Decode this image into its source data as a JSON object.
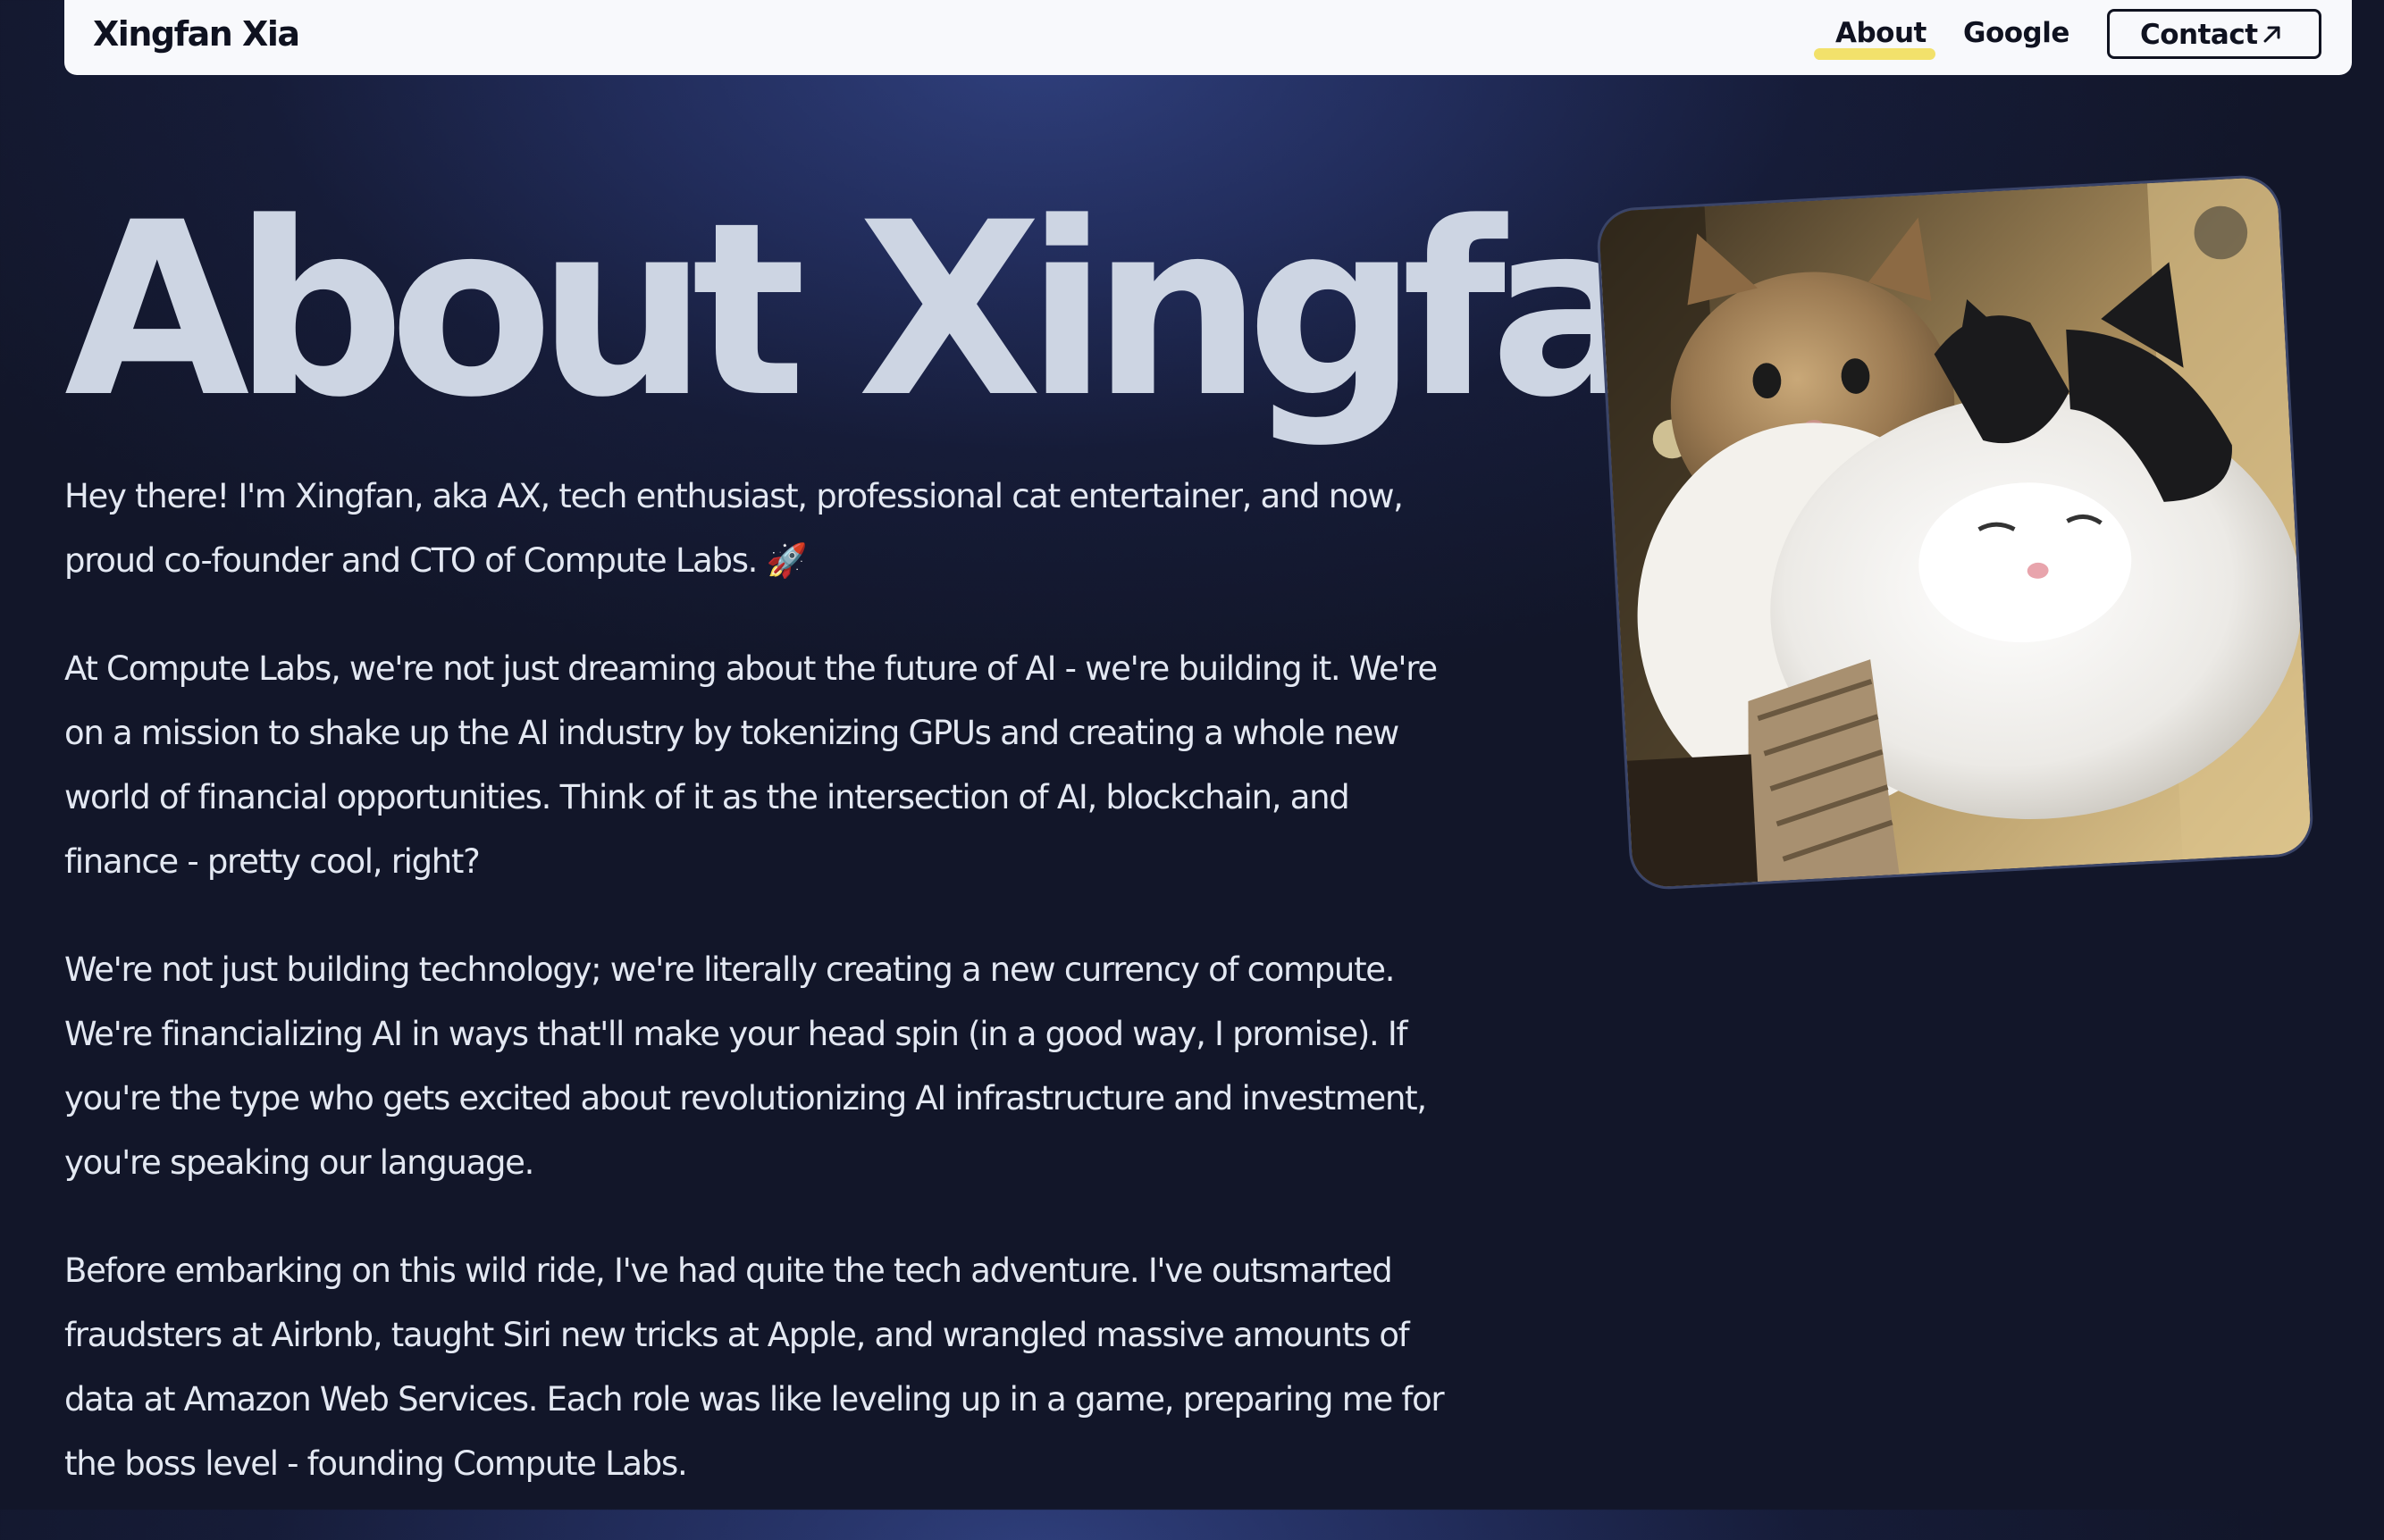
{
  "nav": {
    "brand": "Xingfan Xia",
    "links": [
      {
        "label": "About",
        "active": true
      },
      {
        "label": "Google",
        "active": false
      }
    ],
    "contact_label": "Contact",
    "contact_icon": "arrow-up-right-icon"
  },
  "main": {
    "title": "About Xingfan",
    "paragraphs": [
      "Hey there! I'm Xingfan, aka AX, tech enthusiast, professional cat entertainer, and now, proud co-founder and CTO of Compute Labs. 🚀",
      "At Compute Labs, we're not just dreaming about the future of AI - we're building it. We're on a mission to shake up the AI industry by tokenizing GPUs and creating a whole new world of financial opportunities. Think of it as the intersection of AI, blockchain, and finance - pretty cool, right?",
      "We're not just building technology; we're literally creating a new currency of compute. We're financializing AI in ways that'll make your head spin (in a good way, I promise). If you're the type who gets excited about revolutionizing AI infrastructure and investment, you're speaking our language.",
      "Before embarking on this wild ride, I've had quite the tech adventure. I've outsmarted fraudsters at Airbnb, taught Siri new tricks at Apple, and wrangled massive amounts of data at Amazon Web Services. Each role was like leveling up in a game, preparing me for the boss level - founding Compute Labs."
    ],
    "photo_alt": "two cats photo"
  },
  "colors": {
    "background": "#121629",
    "nav_background": "#f8f9fc",
    "underline_accent": "#f2e16b",
    "title_color": "#cdd5e3",
    "body_text": "#e3e8f2"
  }
}
